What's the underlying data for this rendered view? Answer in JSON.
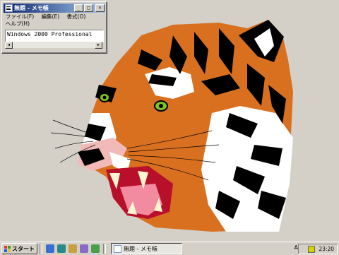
{
  "window": {
    "title": "無題 - メモ帳",
    "buttons": {
      "minimize": "_",
      "maximize": "□",
      "close": "×"
    },
    "menu": [
      "ファイル(F)",
      "編集(E)",
      "書式(O)",
      "ヘルプ(H)"
    ],
    "content": "Windows 2000 Professional"
  },
  "taskbar": {
    "start_label": "スタート",
    "task_label": "無題 - メモ帳",
    "ime_label": "A",
    "clock": "23:20"
  },
  "colors": {
    "tiger_orange": "#d9701f",
    "desktop": "#d4d0c8",
    "titlebar": "#0a246a"
  }
}
